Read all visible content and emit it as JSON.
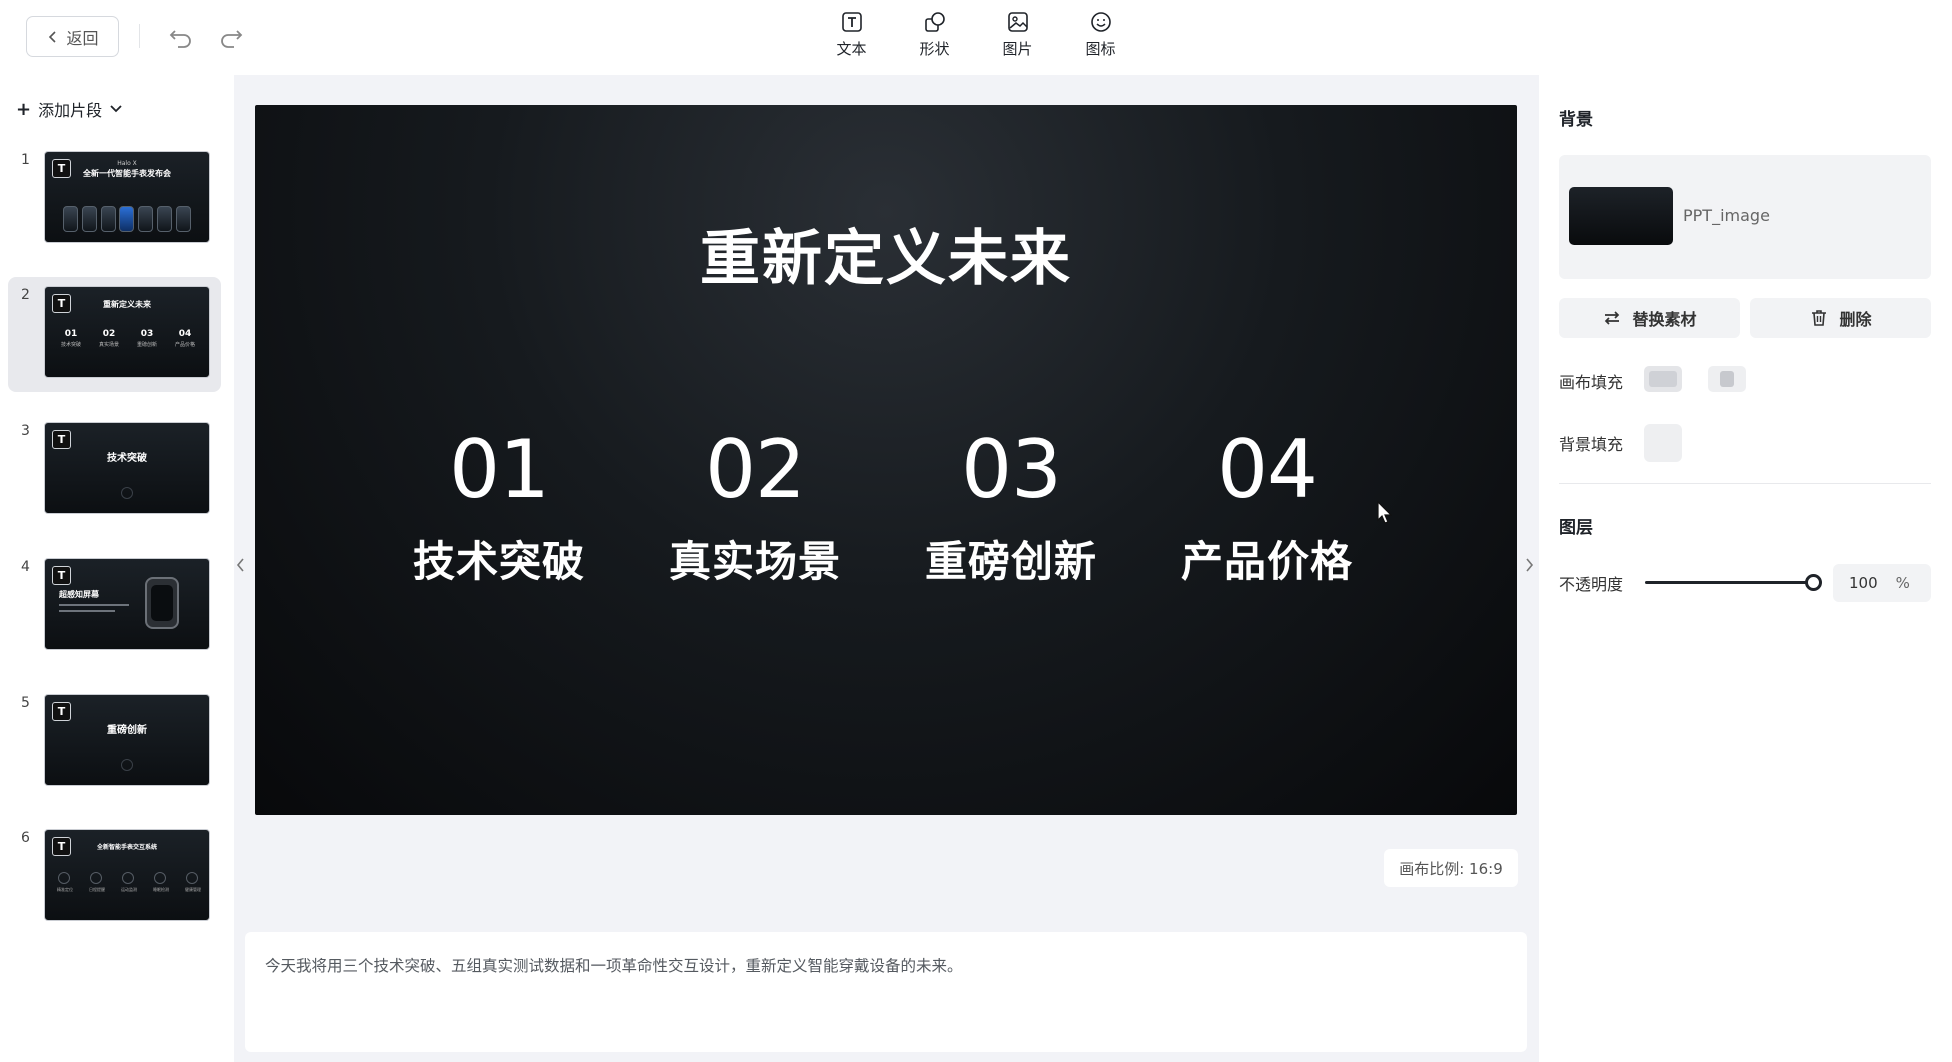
{
  "toolbar": {
    "back_label": "返回",
    "tools": [
      {
        "label": "文本",
        "icon": "text-icon"
      },
      {
        "label": "形状",
        "icon": "shape-icon"
      },
      {
        "label": "图片",
        "icon": "image-icon"
      },
      {
        "label": "图标",
        "icon": "emoji-icon"
      }
    ]
  },
  "sidebar": {
    "add_label": "添加片段",
    "slides": [
      {
        "num": "1",
        "title": "全新一代智能手表发布会",
        "small": "Halo X"
      },
      {
        "num": "2",
        "title": "重新定义未来",
        "items": [
          [
            "01",
            "技术突破"
          ],
          [
            "02",
            "真实场景"
          ],
          [
            "03",
            "重磅创新"
          ],
          [
            "04",
            "产品价格"
          ]
        ]
      },
      {
        "num": "3",
        "title": "技术突破"
      },
      {
        "num": "4",
        "title": "超感知屏幕"
      },
      {
        "num": "5",
        "title": "重磅创新"
      },
      {
        "num": "6",
        "title": "全新智能手表交互系统",
        "icons": [
          "精准定位",
          "日程提醒",
          "运动监测",
          "睡眠检测",
          "健康管理"
        ]
      }
    ]
  },
  "canvas": {
    "title": "重新定义未来",
    "items": [
      {
        "num": "01",
        "label": "技术突破"
      },
      {
        "num": "02",
        "label": "真实场景"
      },
      {
        "num": "03",
        "label": "重磅创新"
      },
      {
        "num": "04",
        "label": "产品价格"
      }
    ],
    "ratio_label": "画布比例: 16:9"
  },
  "notes": {
    "text": "今天我将用三个技术突破、五组真实测试数据和一项革命性交互设计，重新定义智能穿戴设备的未来。"
  },
  "panel": {
    "bg_title": "背景",
    "bg_name": "PPT_image",
    "replace_label": "替换素材",
    "delete_label": "删除",
    "canvas_fill_label": "画布填充",
    "bg_fill_label": "背景填充",
    "layer_title": "图层",
    "opacity_label": "不透明度",
    "opacity_value": "100",
    "opacity_unit": "%"
  }
}
